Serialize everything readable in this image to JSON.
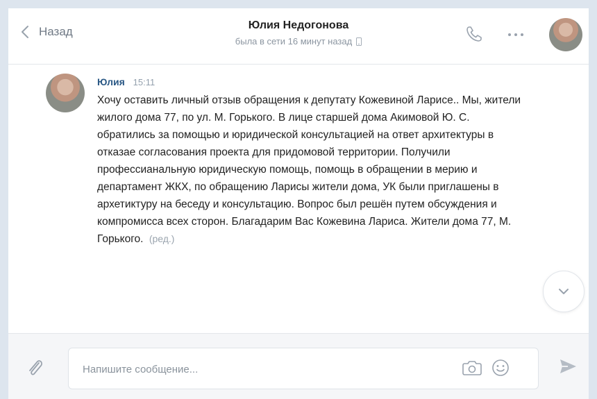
{
  "header": {
    "back_label": "Назад",
    "contact_name": "Юлия Недогонова",
    "status": "была в сети 16 минут назад"
  },
  "message": {
    "author": "Юлия",
    "time": "15:11",
    "text": "Хочу оставить личный отзыв обращения к депутату Кожевиной Ларисе.. Мы, жители жилого дома 77, по ул. М. Горького. В лице старшей дома Акимовой Ю. С. обратились за помощью и юридической консультацией на ответ архитектуры в отказае согласования проекта для придомовой территории. Получили профессианальную юридическую помощь, помощь в обращении в мерию и департамент ЖКХ, по обращению Ларисы жители дома, УК были приглашены в архетиктуру на беседу и консультацию. Вопрос был решён путем обсуждения и компромисса всех сторон. Благадарим Вас Кожевина Лариса. Жители дома 77, М. Горького.",
    "edited_label": "(ред.)"
  },
  "composer": {
    "placeholder": "Напишите сообщение..."
  },
  "icons": {
    "back": "chevron-left-icon",
    "mobile": "mobile-device-icon",
    "phone": "phone-icon",
    "more": "more-dots-icon",
    "scroll": "chevron-down-icon",
    "attach": "paperclip-icon",
    "camera": "camera-icon",
    "smile": "smile-icon",
    "send": "send-icon"
  },
  "colors": {
    "accent": "#2a5885",
    "icon_gray": "#99a2ad",
    "page_bg": "#dde5ee"
  }
}
